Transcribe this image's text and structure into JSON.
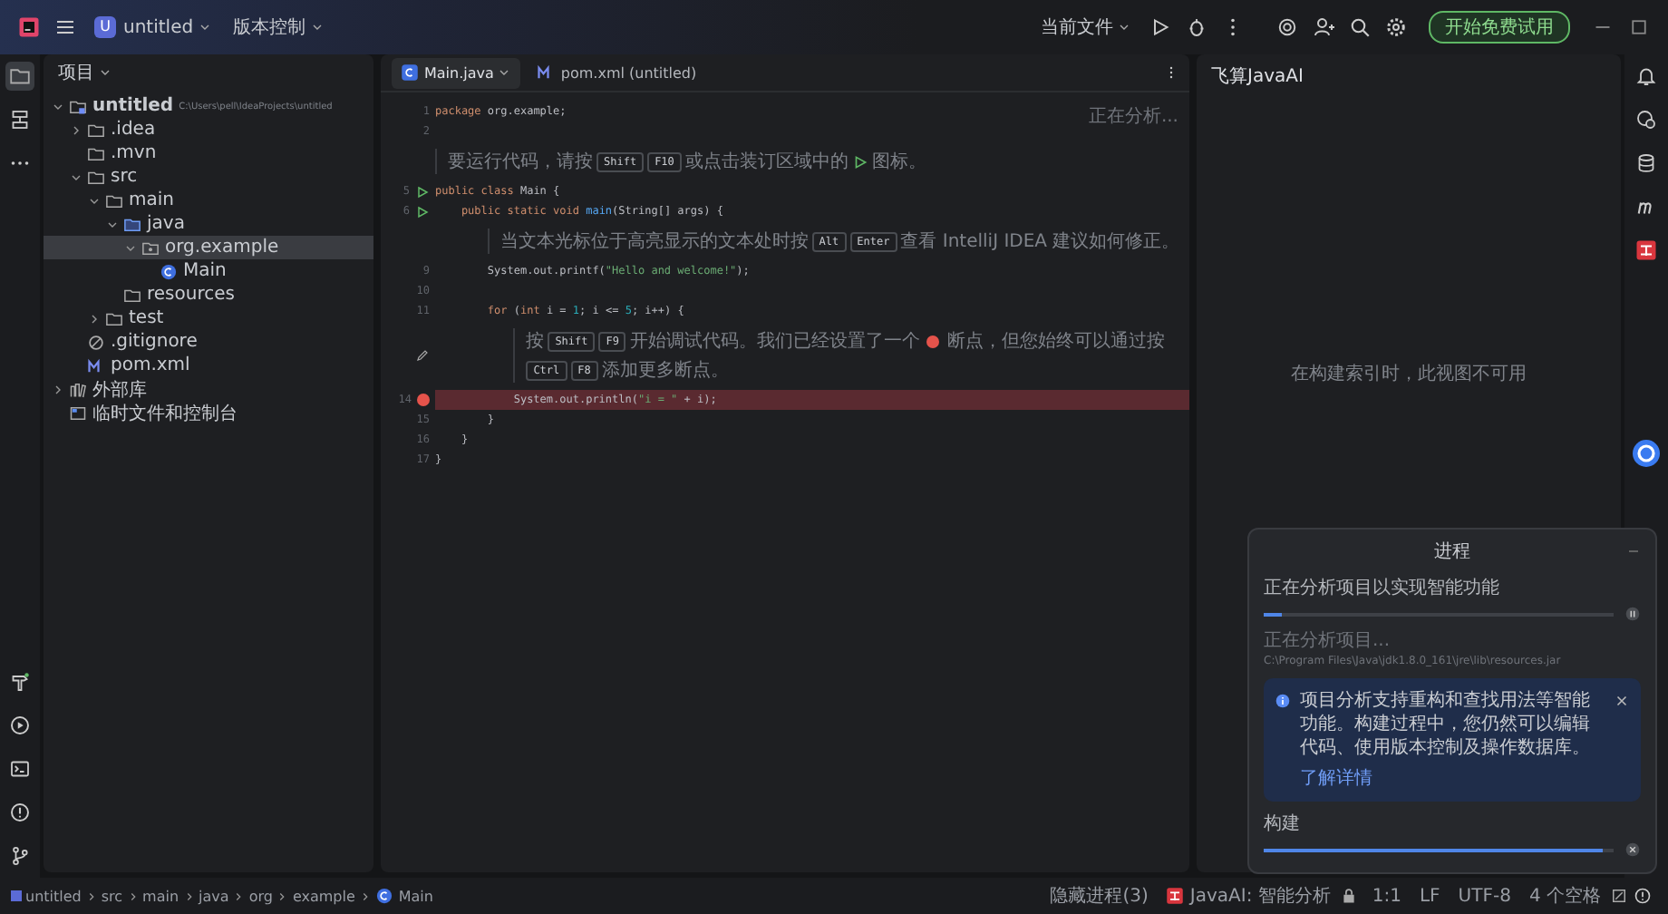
{
  "title_bar": {
    "project_badge": "U",
    "project": "untitled",
    "vcs": "版本控制",
    "run_config": "当前文件",
    "trial_button": "开始免费试用"
  },
  "project_panel": {
    "title": "项目",
    "tree": [
      {
        "label": "untitled",
        "path": "C:\\Users\\pell\\IdeaProjects\\untitled",
        "kind": "module",
        "expanded": true,
        "selected": false,
        "children": [
          {
            "label": ".idea",
            "kind": "folder",
            "expanded": false,
            "selected": false
          },
          {
            "label": ".mvn",
            "kind": "folder",
            "selected": false
          },
          {
            "label": "src",
            "kind": "folder",
            "expanded": true,
            "selected": false,
            "children": [
              {
                "label": "main",
                "kind": "folder",
                "expanded": true,
                "selected": false,
                "children": [
                  {
                    "label": "java",
                    "kind": "source",
                    "expanded": true,
                    "selected": false,
                    "children": [
                      {
                        "label": "org.example",
                        "kind": "package",
                        "expanded": true,
                        "selected": true,
                        "children": [
                          {
                            "label": "Main",
                            "kind": "class",
                            "selected": false
                          }
                        ]
                      }
                    ]
                  },
                  {
                    "label": "resources",
                    "kind": "folder",
                    "selected": false
                  }
                ]
              },
              {
                "label": "test",
                "kind": "folder",
                "expanded": false,
                "selected": false
              }
            ]
          },
          {
            "label": ".gitignore",
            "kind": "ignore",
            "selected": false
          },
          {
            "label": "pom.xml",
            "kind": "maven",
            "selected": false
          }
        ]
      },
      {
        "label": "外部库",
        "kind": "library",
        "expanded": false,
        "selected": false
      },
      {
        "label": "临时文件和控制台",
        "kind": "scratch",
        "selected": false
      }
    ]
  },
  "editor": {
    "tabs": [
      {
        "label": "Main.java",
        "kind": "java",
        "selected": true
      },
      {
        "label": "pom.xml (untitled)",
        "kind": "maven",
        "selected": false
      }
    ],
    "status": "正在分析...",
    "lines": [
      {
        "kind": "code",
        "number": "1",
        "run_gutter": false,
        "breakpoint": false,
        "tokens": [
          {
            "kind": "keyword",
            "text": "package"
          },
          {
            "kind": "plain",
            "text": " org.example;"
          }
        ]
      },
      {
        "kind": "code",
        "number": "2",
        "run_gutter": false,
        "breakpoint": false
      },
      {
        "kind": "hint",
        "edit_gutter": false,
        "parts": [
          {
            "kind": "text",
            "text": "要运行代码，请按"
          },
          {
            "kind": "key",
            "text": "Shift"
          },
          {
            "kind": "key",
            "text": "F10"
          },
          {
            "kind": "text",
            "text": "或点击装订区域中的"
          },
          {
            "kind": "run-icon"
          },
          {
            "kind": "text",
            "text": "图标。"
          }
        ]
      },
      {
        "kind": "code",
        "number": "5",
        "run_gutter": true,
        "breakpoint": false,
        "tokens": [
          {
            "kind": "keyword",
            "text": "public class"
          },
          {
            "kind": "plain",
            "text": " Main {"
          }
        ]
      },
      {
        "kind": "code",
        "number": "6",
        "run_gutter": true,
        "breakpoint": false,
        "tokens": [
          {
            "kind": "keyword",
            "text": "    public static void"
          },
          {
            "kind": "method",
            "text": " main"
          },
          {
            "kind": "plain",
            "text": "(String[] args) {"
          }
        ]
      },
      {
        "kind": "hint",
        "edit_gutter": false,
        "parts": [
          {
            "kind": "text",
            "text": "当文本光标位于高亮显示的文本处时按"
          },
          {
            "kind": "key",
            "text": "Alt"
          },
          {
            "kind": "key",
            "text": "Enter"
          },
          {
            "kind": "text",
            "text": "查看 IntelliJ IDEA 建议如何修正。"
          }
        ]
      },
      {
        "kind": "code",
        "number": "9",
        "run_gutter": false,
        "breakpoint": false,
        "tokens": [
          {
            "kind": "plain",
            "text": "        System.out.printf("
          },
          {
            "kind": "string",
            "text": "\"Hello and welcome!\""
          },
          {
            "kind": "plain",
            "text": ");"
          }
        ]
      },
      {
        "kind": "code",
        "number": "10",
        "run_gutter": false,
        "breakpoint": false
      },
      {
        "kind": "code",
        "number": "11",
        "run_gutter": false,
        "breakpoint": false,
        "tokens": [
          {
            "kind": "keyword",
            "text": "        for"
          },
          {
            "kind": "plain",
            "text": " ("
          },
          {
            "kind": "keyword",
            "text": "int"
          },
          {
            "kind": "plain",
            "text": " i = "
          },
          {
            "kind": "number",
            "text": "1"
          },
          {
            "kind": "plain",
            "text": "; i <= "
          },
          {
            "kind": "number",
            "text": "5"
          },
          {
            "kind": "plain",
            "text": "; i++) {"
          }
        ]
      },
      {
        "kind": "hint",
        "edit_gutter": true,
        "parts": [
          {
            "kind": "text",
            "text": "按"
          },
          {
            "kind": "key",
            "text": "Shift"
          },
          {
            "kind": "key",
            "text": "F9"
          },
          {
            "kind": "text",
            "text": "开始调试代码。我们已经设置了一个"
          },
          {
            "kind": "breakpoint-icon"
          },
          {
            "kind": "text",
            "text": "断点，但您始终可以通过按"
          },
          {
            "kind": "key",
            "text": "Ctrl"
          },
          {
            "kind": "key",
            "text": "F8"
          },
          {
            "kind": "text",
            "text": "添加更多断点。"
          }
        ]
      },
      {
        "kind": "code",
        "number": "14",
        "run_gutter": false,
        "breakpoint": true,
        "tokens": [
          {
            "kind": "plain",
            "text": "            System.out.println("
          },
          {
            "kind": "string",
            "text": "\"i = \""
          },
          {
            "kind": "plain",
            "text": " + i);"
          }
        ]
      },
      {
        "kind": "code",
        "number": "15",
        "run_gutter": false,
        "breakpoint": false,
        "tokens": [
          {
            "kind": "plain",
            "text": "        }"
          }
        ]
      },
      {
        "kind": "code",
        "number": "16",
        "run_gutter": false,
        "breakpoint": false,
        "tokens": [
          {
            "kind": "plain",
            "text": "    }"
          }
        ]
      },
      {
        "kind": "code",
        "number": "17",
        "run_gutter": false,
        "breakpoint": false,
        "tokens": [
          {
            "kind": "plain",
            "text": "}"
          }
        ]
      }
    ]
  },
  "ai_panel": {
    "title": "飞算JavaAI",
    "message": "在构建索引时，此视图不可用"
  },
  "progress_popup": {
    "title": "进程",
    "tasks": [
      {
        "title": "正在分析项目以实现智能功能",
        "level": 0.05,
        "detail": "正在分析项目...",
        "path": "C:\\Program Files\\Java\\jdk1.8.0_161\\jre\\lib\\resources.jar"
      }
    ],
    "notice": {
      "text": "项目分析支持重构和查找用法等智能功能。构建过程中，您仍然可以编辑代码、使用版本控制及操作数据库。",
      "link": "了解详情"
    },
    "build": {
      "title": "构建",
      "level": 0.97
    }
  },
  "status_bar": {
    "breadcrumbs": [
      {
        "label": "untitled",
        "kind": "module"
      },
      {
        "label": "src"
      },
      {
        "label": "main"
      },
      {
        "label": "java"
      },
      {
        "label": "org"
      },
      {
        "label": "example"
      },
      {
        "label": "Main",
        "kind": "class"
      }
    ],
    "hidden_processes": "隐藏进程(3)",
    "ai": "JavaAI: 智能分析",
    "position": "1:1",
    "line_ending": "LF",
    "encoding": "UTF-8",
    "indent": "4 个空格"
  }
}
